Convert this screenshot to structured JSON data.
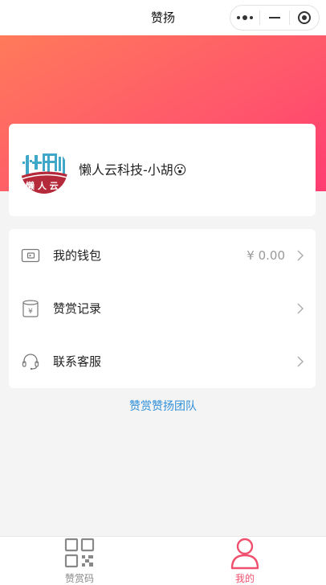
{
  "nav": {
    "title": "赞扬"
  },
  "profile": {
    "avatar_label": "懒人云",
    "username": "懒人云科技-小胡😮"
  },
  "menu": [
    {
      "label": "我的钱包",
      "value": "¥ 0.00",
      "icon": "wallet-icon"
    },
    {
      "label": "赞赏记录",
      "value": "",
      "icon": "records-icon"
    },
    {
      "label": "联系客服",
      "value": "",
      "icon": "headset-icon"
    }
  ],
  "footer_link": "赞赏赞扬团队",
  "tabbar": [
    {
      "label": "赞赏码",
      "icon": "qr-code-icon",
      "active": false
    },
    {
      "label": "我的",
      "icon": "user-icon",
      "active": true
    }
  ],
  "colors": {
    "accent": "#f0506e",
    "link": "#2f8fd8",
    "banner_start": "#ff7a5a",
    "banner_end": "#ff3d72"
  }
}
